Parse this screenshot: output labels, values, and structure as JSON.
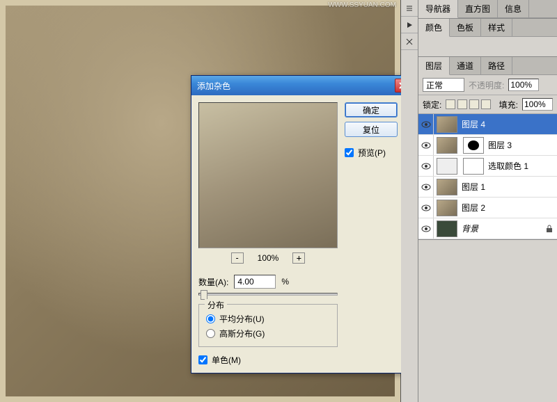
{
  "watermark": "WWW.SSYUAN.COM",
  "top_tabs": {
    "nav": "导航器",
    "histogram": "直方图",
    "info": "信息"
  },
  "color_tabs": {
    "color": "颜色",
    "swatch": "色板",
    "style": "样式"
  },
  "layer_tabs": {
    "layer": "图层",
    "channel": "通道",
    "path": "路径"
  },
  "blend_mode": "正常",
  "opacity_label": "不透明度:",
  "opacity_value": "100%",
  "lock_label": "锁定:",
  "fill_label": "填充:",
  "fill_value": "100%",
  "layers": [
    {
      "name": "图层 4",
      "selected": true
    },
    {
      "name": "图层 3",
      "mask": true
    },
    {
      "name": "选取颜色 1",
      "adjust": true
    },
    {
      "name": "图层 1"
    },
    {
      "name": "图层 2"
    },
    {
      "name": "背景",
      "bg": true
    }
  ],
  "dialog": {
    "title": "添加杂色",
    "ok": "确定",
    "cancel": "复位",
    "preview": "预览(P)",
    "zoom_percent": "100%",
    "amount_label": "数量(A):",
    "amount_value": "4.00",
    "amount_unit": "%",
    "distribution_legend": "分布",
    "uniform": "平均分布(U)",
    "gaussian": "高斯分布(G)",
    "mono": "单色(M)"
  }
}
